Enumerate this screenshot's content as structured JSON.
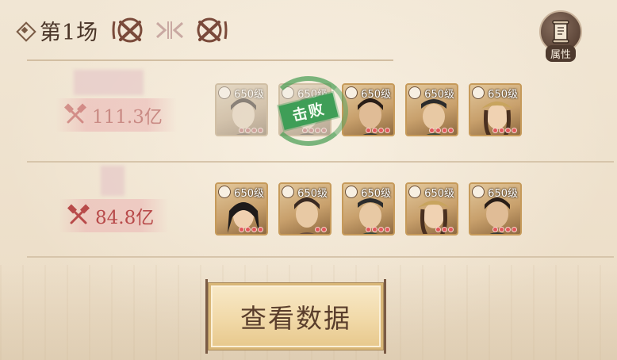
{
  "header": {
    "title": "第1场",
    "attr_label": "属性"
  },
  "teams": [
    {
      "power": "111.3亿",
      "defeated": true,
      "defeat_label": "击败",
      "heroes": [
        {
          "level": "650级",
          "stars": 4,
          "icon": "class-icon"
        },
        {
          "level": "650级",
          "stars": 4,
          "icon": "class-icon"
        },
        {
          "level": "650级",
          "stars": 4,
          "icon": "class-icon"
        },
        {
          "level": "650级",
          "stars": 4,
          "icon": "class-icon"
        },
        {
          "level": "650级",
          "stars": 4,
          "icon": "class-icon"
        }
      ]
    },
    {
      "power": "84.8亿",
      "defeated": false,
      "heroes": [
        {
          "level": "650级",
          "stars": 4,
          "icon": "class-icon"
        },
        {
          "level": "650级",
          "stars": 2,
          "icon": "class-icon"
        },
        {
          "level": "650级",
          "stars": 4,
          "icon": "class-icon"
        },
        {
          "level": "650级",
          "stars": 3,
          "icon": "class-icon"
        },
        {
          "level": "650级",
          "stars": 4,
          "icon": "class-icon"
        }
      ]
    }
  ],
  "view_button": {
    "label": "查看数据"
  },
  "colors": {
    "accent": "#b84a4a",
    "defeat_green": "#3f9e57",
    "frame_gold": "#c69a5a"
  }
}
